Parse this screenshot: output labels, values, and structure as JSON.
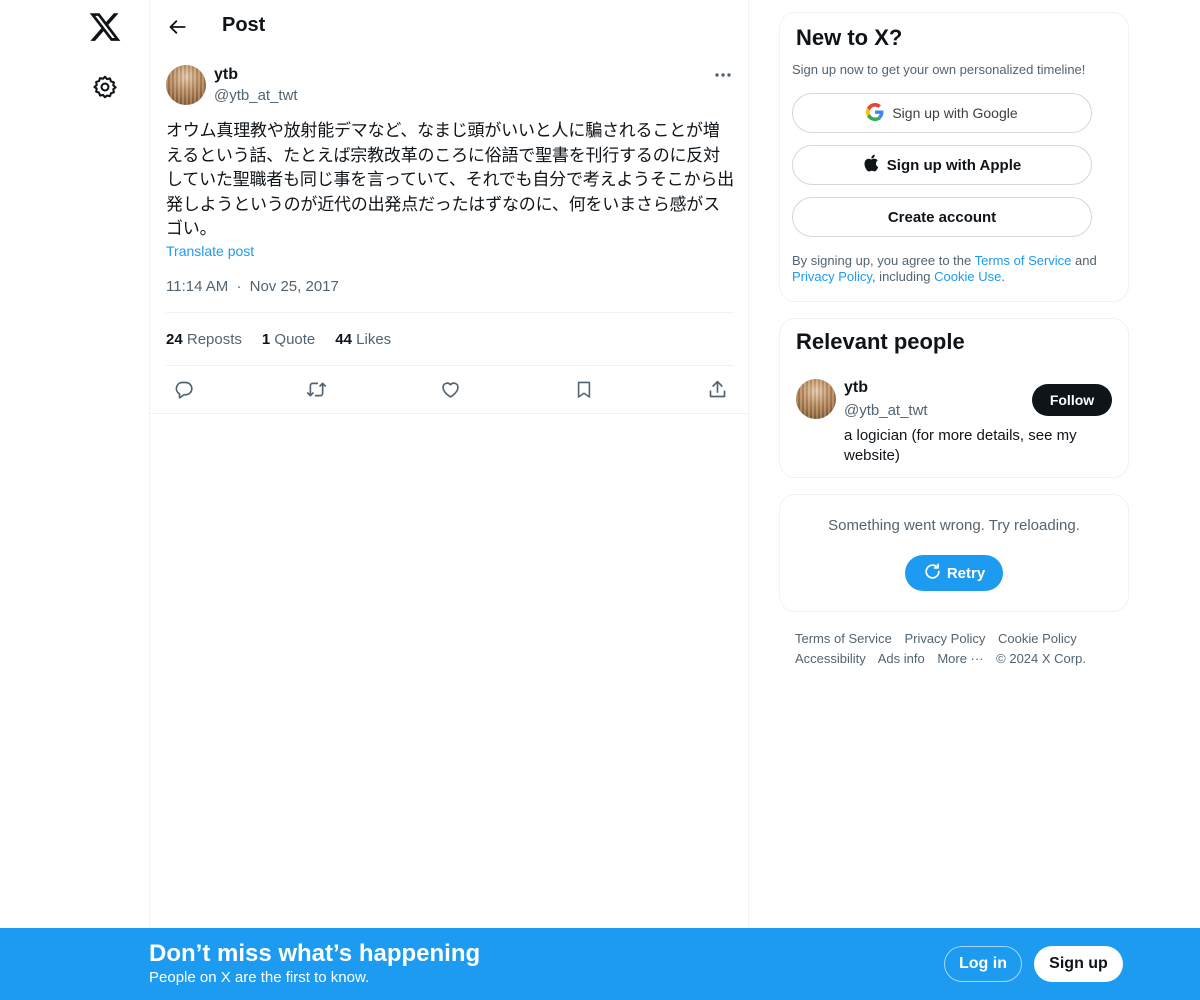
{
  "nav": {
    "logo_icon": "x-logo-icon",
    "settings_icon": "gear-icon"
  },
  "header": {
    "back_icon": "arrow-left-icon",
    "title": "Post"
  },
  "post": {
    "author_name": "ytb",
    "author_handle": "@ytb_at_twt",
    "text": "オウム真理教や放射能デマなど、なまじ頭がいいと人に騙されることが増えるという話、たとえば宗教改革のころに俗語で聖書を刊行するのに反対していた聖職者も同じ事を言っていて、それでも自分で考えようそこから出発しようというのが近代の出発点だったはずなのに、何をいまさら感がスゴい。",
    "translate_label": "Translate post",
    "time": "11:14 AM",
    "separator": "·",
    "date": "Nov 25, 2017",
    "stats": {
      "reposts_count": "24",
      "reposts_label": "Reposts",
      "quotes_count": "1",
      "quotes_label": "Quote",
      "likes_count": "44",
      "likes_label": "Likes"
    },
    "actions": [
      "reply-icon",
      "repost-icon",
      "like-icon",
      "bookmark-icon",
      "share-icon"
    ]
  },
  "signup_card": {
    "title": "New to X?",
    "subtitle": "Sign up now to get your own personalized timeline!",
    "google_label": "Sign up with Google",
    "apple_label": "Sign up with Apple",
    "create_label": "Create account",
    "legal_prefix": "By signing up, you agree to the ",
    "terms_link": "Terms of Service",
    "legal_and": " and ",
    "privacy_link": "Privacy Policy",
    "legal_including": ", including ",
    "cookie_link": "Cookie Use",
    "legal_suffix": "."
  },
  "relevant_people": {
    "title": "Relevant people",
    "name": "ytb",
    "handle": "@ytb_at_twt",
    "follow_label": "Follow",
    "bio": "a logician (for more details, see my website)"
  },
  "error_card": {
    "message": "Something went wrong. Try reloading.",
    "retry_label": "Retry"
  },
  "footer": {
    "terms": "Terms of Service",
    "privacy": "Privacy Policy",
    "cookie": "Cookie Policy",
    "accessibility": "Accessibility",
    "ads": "Ads info",
    "more": "More ···",
    "copyright": "© 2024 X Corp."
  },
  "banner": {
    "title": "Don’t miss what’s happening",
    "subtitle": "People on X are the first to know.",
    "login_label": "Log in",
    "signup_label": "Sign up",
    "background": "#1d9bf0"
  },
  "colors": {
    "accent": "#1d9bf0",
    "text": "#0f1419",
    "muted": "#536471",
    "border": "#eff3f4"
  }
}
